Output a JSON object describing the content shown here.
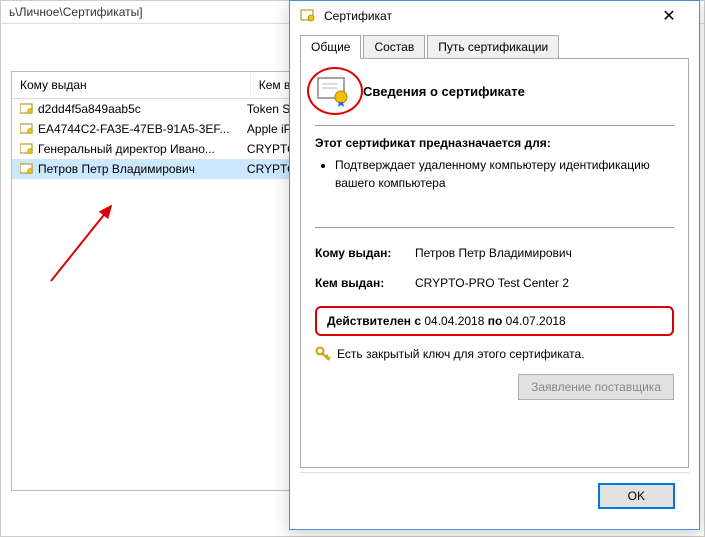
{
  "breadcrumb": "ь\\Личное\\Сертификаты]",
  "list": {
    "headers": {
      "issued_to": "Кому выдан",
      "issued_by": "Кем выдан"
    },
    "rows": [
      {
        "name": "d2dd4f5a849aab5c",
        "issuer": "Token Signing"
      },
      {
        "name": "EA4744C2-FA3E-47EB-91A5-3EF...",
        "issuer": "Apple iPhone"
      },
      {
        "name": "Генеральный директор Ивано...",
        "issuer": "CRYPTO-PRO"
      },
      {
        "name": "Петров Петр Владимирович",
        "issuer": "CRYPTO-PRO"
      }
    ]
  },
  "dialog": {
    "title": "Сертификат",
    "tabs": {
      "general": "Общие",
      "composition": "Состав",
      "path": "Путь сертификации"
    },
    "info_title": "Сведения о сертификате",
    "purpose_title": "Этот сертификат предназначается для:",
    "purposes": [
      "Подтверждает удаленному компьютеру идентификацию вашего компьютера"
    ],
    "issued_to_label": "Кому выдан:",
    "issued_to_value": "Петров Петр Владимирович",
    "issued_by_label": "Кем выдан:",
    "issued_by_value": "CRYPTO-PRO Test Center 2",
    "validity": {
      "prefix": "Действителен с ",
      "from": "04.04.2018",
      "mid": " по ",
      "to": "04.07.2018"
    },
    "key_text": "Есть закрытый ключ для этого сертификата.",
    "supplier_btn": "Заявление поставщика",
    "ok": "OK"
  }
}
